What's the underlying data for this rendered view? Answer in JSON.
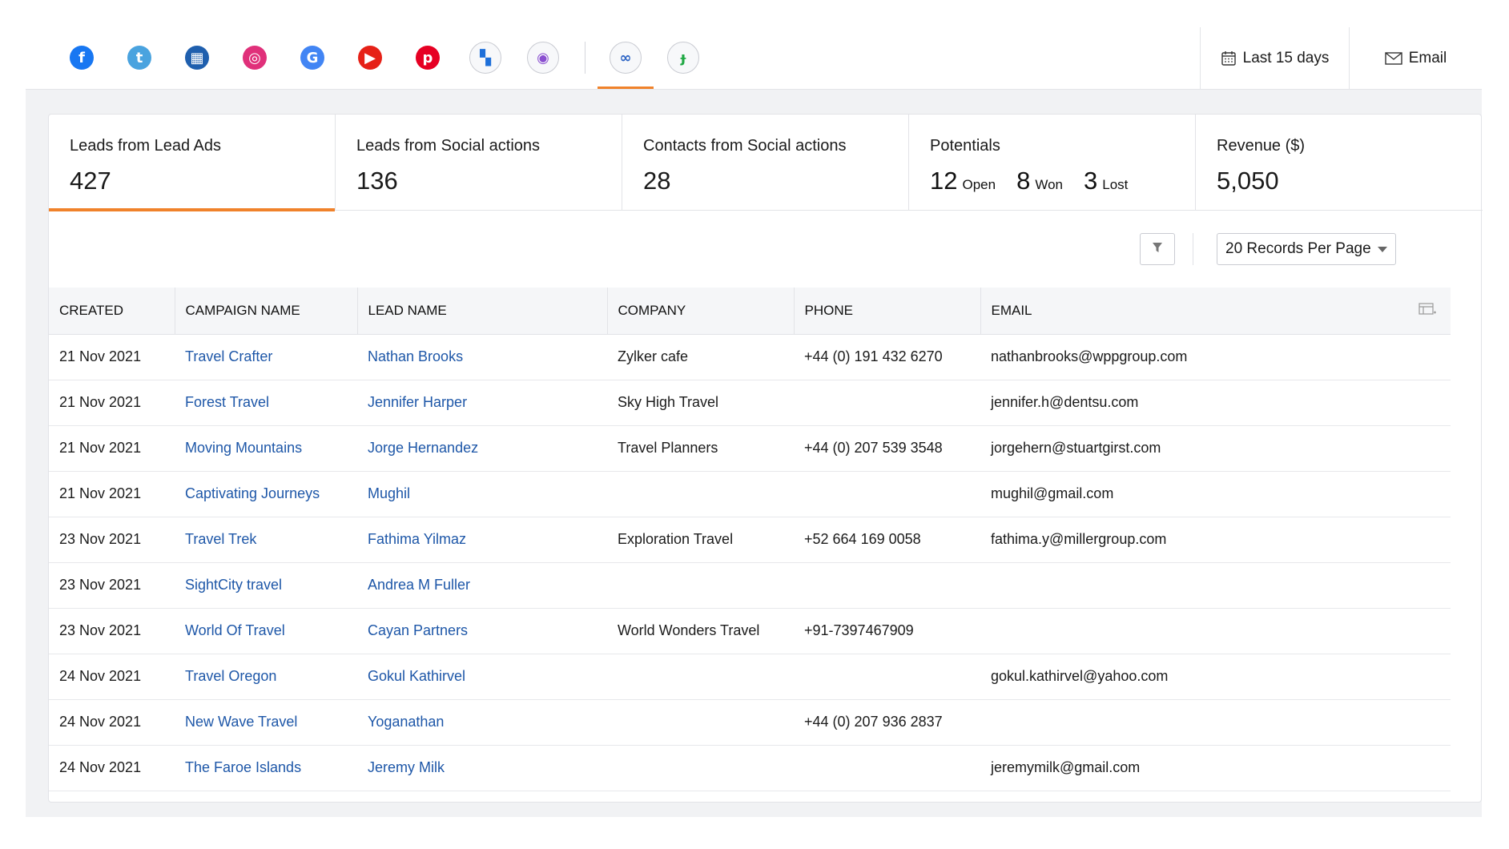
{
  "topbar": {
    "networks": [
      {
        "name": "facebook",
        "icon": "facebook-icon",
        "glyph": "f",
        "color": "#1877f2"
      },
      {
        "name": "twitter",
        "icon": "twitter-icon",
        "glyph": "t",
        "color": "#4aa3df"
      },
      {
        "name": "google-my-business",
        "icon": "building-icon",
        "glyph": "▦",
        "color": "#1f5fae"
      },
      {
        "name": "instagram",
        "icon": "instagram-icon",
        "glyph": "◎",
        "color": "#e0307a"
      },
      {
        "name": "google",
        "icon": "google-icon",
        "glyph": "G",
        "color": "#4285f4"
      },
      {
        "name": "youtube",
        "icon": "youtube-icon",
        "glyph": "▶",
        "color": "#e62117"
      },
      {
        "name": "pinterest",
        "icon": "pinterest-icon",
        "glyph": "p",
        "color": "#e60023"
      },
      {
        "name": "tiles",
        "icon": "tiles-icon",
        "glyph": "▚",
        "color": "#1e6fd9",
        "outlined": true
      },
      {
        "name": "target",
        "icon": "target-icon",
        "glyph": "◉",
        "color": "#8a4fd0",
        "outlined": true
      },
      {
        "name": "crm-integration",
        "icon": "crm-link-icon",
        "glyph": "∞",
        "color": "#2b63c4",
        "outlined": true,
        "active": true
      },
      {
        "name": "bookings",
        "icon": "bookings-icon",
        "glyph": "ɟ",
        "color": "#1fa843",
        "outlined": true
      }
    ],
    "date_range_label": "Last 15 days",
    "email_label": "Email"
  },
  "stats": {
    "leads_lead_ads": {
      "title": "Leads from Lead Ads",
      "value": "427"
    },
    "leads_social": {
      "title": "Leads from Social actions",
      "value": "136"
    },
    "contacts_social": {
      "title": "Contacts from Social actions",
      "value": "28"
    },
    "potentials": {
      "title": "Potentials",
      "open_value": "12",
      "open_label": "Open",
      "won_value": "8",
      "won_label": "Won",
      "lost_value": "3",
      "lost_label": "Lost"
    },
    "revenue": {
      "title": "Revenue ($)",
      "value": "5,050"
    }
  },
  "toolbar": {
    "records_per_page": "20 Records Per Page"
  },
  "table": {
    "headers": [
      "CREATED",
      "CAMPAIGN NAME",
      "LEAD NAME",
      "COMPANY",
      "PHONE",
      "EMAIL"
    ],
    "rows": [
      [
        "21 Nov 2021",
        "Travel Crafter",
        "Nathan Brooks",
        "Zylker cafe",
        "+44 (0) 191 432 6270",
        "nathanbrooks@wppgroup.com"
      ],
      [
        "21 Nov 2021",
        "Forest Travel",
        "Jennifer Harper",
        "Sky High Travel",
        "",
        "jennifer.h@dentsu.com"
      ],
      [
        "21 Nov 2021",
        "Moving Mountains",
        "Jorge Hernandez",
        "Travel Planners",
        "+44 (0) 207 539 3548",
        "jorgehern@stuartgirst.com"
      ],
      [
        "21 Nov 2021",
        "Captivating Journeys",
        "Mughil",
        "",
        "",
        "mughil@gmail.com"
      ],
      [
        "23 Nov 2021",
        "Travel Trek",
        "Fathima Yilmaz",
        "Exploration Travel",
        "+52 664 169 0058",
        "fathima.y@millergroup.com"
      ],
      [
        "23 Nov 2021",
        "SightCity travel",
        "Andrea M Fuller",
        "",
        "",
        ""
      ],
      [
        "23 Nov 2021",
        "World Of Travel",
        "Cayan Partners",
        "World Wonders Travel",
        "+91-7397467909",
        ""
      ],
      [
        "24 Nov 2021",
        "Travel Oregon",
        "Gokul Kathirvel",
        "",
        "",
        "gokul.kathirvel@yahoo.com"
      ],
      [
        "24 Nov 2021",
        "New Wave Travel",
        "Yoganathan",
        "",
        "+44 (0) 207 936 2837",
        ""
      ],
      [
        "24 Nov 2021",
        "The Faroe Islands",
        "Jeremy Milk",
        "",
        "",
        "jeremymilk@gmail.com"
      ]
    ]
  },
  "colors": {
    "accent": "#f0822b",
    "link": "#1e57a8"
  }
}
